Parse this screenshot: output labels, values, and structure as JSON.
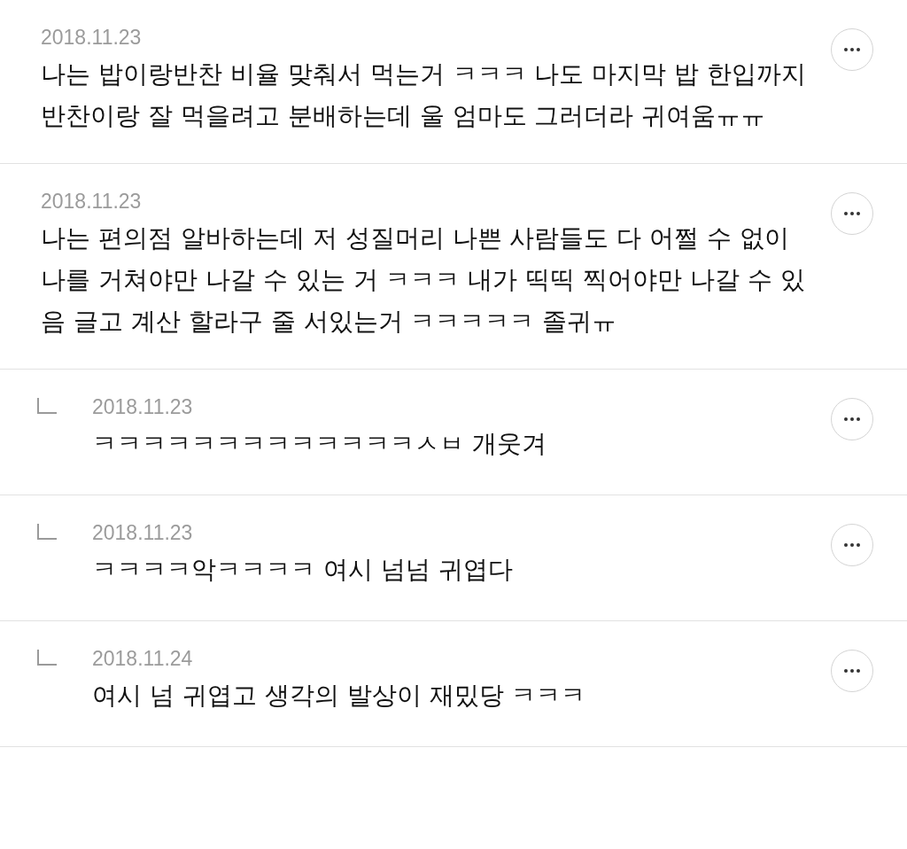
{
  "comments": [
    {
      "kind": "comment",
      "date": "2018.11.23",
      "body": "나는 밥이랑반찬 비율 맞춰서 먹는거 ㅋㅋㅋ 나도 마지막 밥 한입까지 반찬이랑 잘 먹을려고 분배하는데 울 엄마도 그러더라 귀여움ㅠㅠ"
    },
    {
      "kind": "comment",
      "date": "2018.11.23",
      "body": "나는 편의점 알바하는데 저 성질머리 나쁜 사람들도 다 어쩔 수 없이 나를 거쳐야만 나갈 수 있는 거 ㅋㅋㅋ 내가 띡띡 찍어야만 나갈 수 있음 글고 계산 할라구 줄 서있는거 ㅋㅋㅋㅋㅋ 졸귀ㅠ"
    },
    {
      "kind": "reply",
      "date": "2018.11.23",
      "body": "ㅋㅋㅋㅋㅋㅋㅋㅋㅋㅋㅋㅋㅋㅅㅂ 개웃겨"
    },
    {
      "kind": "reply",
      "date": "2018.11.23",
      "body": "ㅋㅋㅋㅋ악ㅋㅋㅋㅋ 여시 넘넘 귀엽다"
    },
    {
      "kind": "reply",
      "date": "2018.11.24",
      "body": "여시 넘 귀엽고 생각의 발상이 재밌당 ㅋㅋㅋ"
    }
  ]
}
